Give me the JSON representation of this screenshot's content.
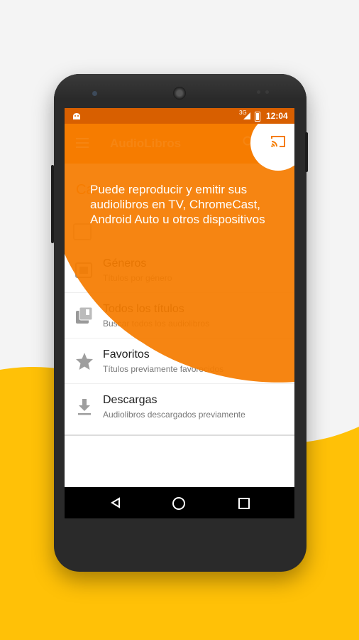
{
  "colors": {
    "accent": "#f57c00",
    "accent_dark": "#d85f00",
    "yellow_background": "#ffc107"
  },
  "status_bar": {
    "network": "3G",
    "time": "12:04"
  },
  "app_bar": {
    "title": "AudioLibros",
    "menu_icon": "hamburger-icon",
    "search_icon": "search-icon",
    "cast_icon": "cast-icon"
  },
  "content": {
    "section_header": "Ca"
  },
  "list": {
    "items": [
      {
        "title": "Géneros",
        "subtitle": "Títulos por género",
        "icon": "genre-icon"
      },
      {
        "title": "Todos los títulos",
        "subtitle": "Buscar todos los audiolibros",
        "icon": "library-icon"
      },
      {
        "title": "Favoritos",
        "subtitle": "Títulos previamente favorecidos",
        "icon": "star-icon"
      },
      {
        "title": "Descargas",
        "subtitle": "Audiolibros descargados previamente",
        "icon": "download-icon"
      }
    ]
  },
  "tooltip": {
    "text": "Puede reproducir y emitir sus audiolibros en TV, ChromeCast, Android Auto u otros dispositivos"
  },
  "nav_bar": {
    "back_icon": "back-icon",
    "home_icon": "home-icon",
    "recents_icon": "recents-icon"
  }
}
